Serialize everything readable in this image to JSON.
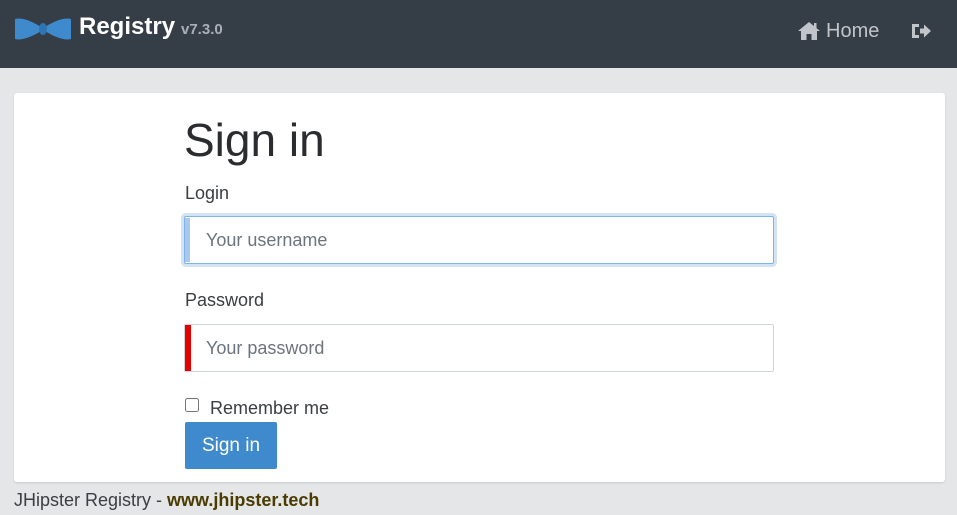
{
  "navbar": {
    "brand_title": "Registry",
    "brand_version": "v7.3.0",
    "home_label": "Home",
    "colors": {
      "background": "#353d47",
      "logo": "#3e8acc"
    },
    "icons": {
      "home": "home-icon",
      "logout": "logout-icon"
    }
  },
  "form": {
    "title": "Sign in",
    "login_label": "Login",
    "username_placeholder": "Your username",
    "password_label": "Password",
    "password_placeholder": "Your password",
    "remember_label": "Remember me",
    "remember_checked": false,
    "submit_label": "Sign in"
  },
  "footer": {
    "text": "JHipster Registry - ",
    "link_text": "www.jhipster.tech"
  }
}
